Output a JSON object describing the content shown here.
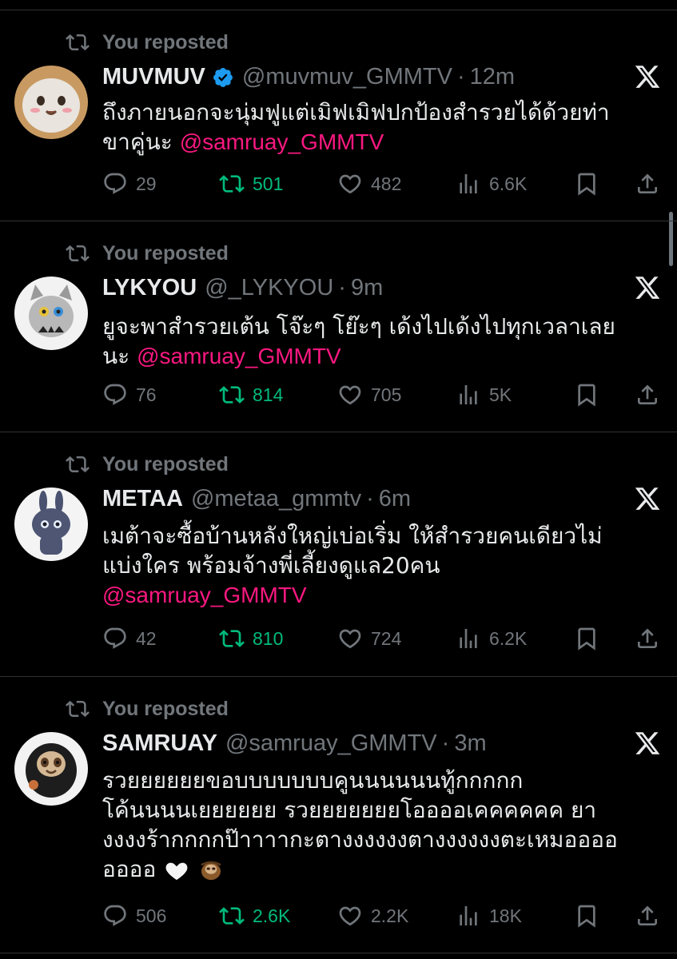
{
  "colors": {
    "background": "#000000",
    "text": "#e7e9ea",
    "muted": "#71767b",
    "mention": "#f91880",
    "repost": "#00ba7c",
    "verified": "#1d9bf0"
  },
  "tweets": [
    {
      "repost_label": "You reposted",
      "name": "MUVMUV",
      "verified": true,
      "handle": "@muvmuv_GMMTV",
      "time": "12m",
      "lines": [
        "ถึงภายนอกจะนุ่มฟูแต่เมิฟเมิฟปกป้องสำรวยได้ด้วยท่า",
        "ขาคู่นะ "
      ],
      "mention": "@samruay_GMMTV",
      "replies": "29",
      "reposts": "501",
      "likes": "482",
      "views": "6.6K"
    },
    {
      "repost_label": "You reposted",
      "name": "LYKYOU",
      "verified": false,
      "handle": "@_LYKYOU",
      "time": "9m",
      "lines": [
        "ยูจะพาสำรวยเต้น โจ๊ะๆ โย๊ะๆ เด้งไปเด้งไปทุกเวลาเลย",
        "นะ "
      ],
      "mention": "@samruay_GMMTV",
      "replies": "76",
      "reposts": "814",
      "likes": "705",
      "views": "5K"
    },
    {
      "repost_label": "You reposted",
      "name": "METAA",
      "verified": false,
      "handle": "@metaa_gmmtv",
      "time": "6m",
      "lines": [
        "เมต้าจะซื้อบ้านหลังใหญ่เบ่อเริ่ม ให้สำรวยคนเดียวไม่",
        "แบ่งใคร พร้อมจ้างพี่เลี้ยงดูแล20คน"
      ],
      "mention": "@samruay_GMMTV",
      "replies": "42",
      "reposts": "810",
      "likes": "724",
      "views": "6.2K"
    },
    {
      "repost_label": "You reposted",
      "name": "SAMRUAY",
      "verified": false,
      "handle": "@samruay_GMMTV",
      "time": "3m",
      "lines": [
        "รวยยยยยยขอบบบบบบบคูนนนนนนทู้กกกกก",
        "โค้นนนนเยยยยยย รวยยยยยยยโออออเคคคคคค ยา",
        "งงงงร้ากกกกป๊าาาากะตางงงงงงตางงงงงงตะเหมออออ",
        "ออออ"
      ],
      "mention": "",
      "replies": "506",
      "reposts": "2.6K",
      "likes": "2.2K",
      "views": "18K"
    }
  ]
}
